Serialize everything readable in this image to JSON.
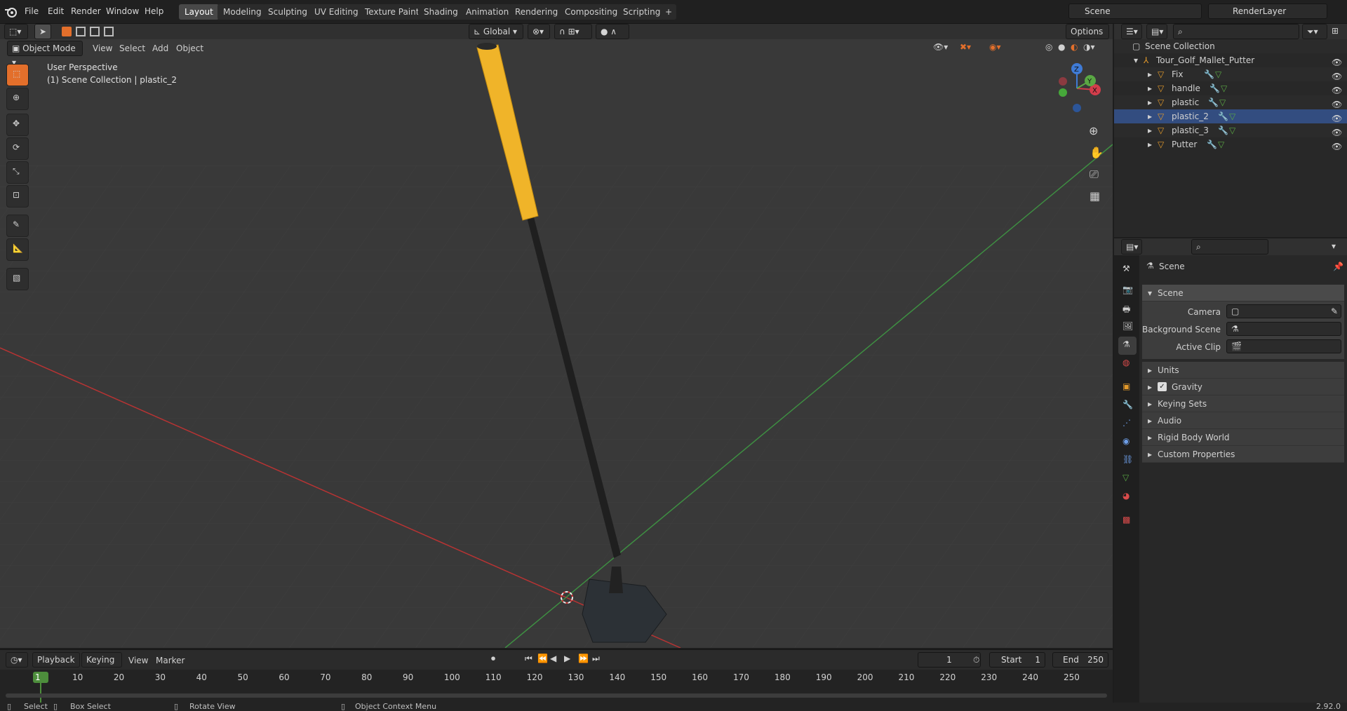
{
  "menus": [
    "File",
    "Edit",
    "Render",
    "Window",
    "Help"
  ],
  "workspaces": [
    "Layout",
    "Modeling",
    "Sculpting",
    "UV Editing",
    "Texture Paint",
    "Shading",
    "Animation",
    "Rendering",
    "Compositing",
    "Scripting"
  ],
  "active_workspace": "Layout",
  "add_workspace": "+",
  "scene_name": "Scene",
  "render_layer": "RenderLayer",
  "viewport": {
    "mode": "Object Mode",
    "menu_items": [
      "View",
      "Select",
      "Add",
      "Object"
    ],
    "orientation": "Global",
    "options_label": "Options",
    "overlay_title": "User Perspective",
    "overlay_subtitle": "(1) Scene Collection | plastic_2",
    "axes": {
      "x": "X",
      "y": "Y",
      "z": "Z"
    }
  },
  "outliner": {
    "search_placeholder": "",
    "root": "Scene Collection",
    "collection": "Tour_Golf_Mallet_Putter",
    "objects": [
      "Fix",
      "handle",
      "plastic",
      "plastic_2",
      "plastic_3",
      "Putter"
    ],
    "selected": "plastic_2"
  },
  "properties": {
    "context_label": "Scene",
    "panel_scene": "Scene",
    "fields": [
      {
        "label": "Camera"
      },
      {
        "label": "Background Scene"
      },
      {
        "label": "Active Clip"
      }
    ],
    "collapsed_panels": [
      "Units",
      "Gravity",
      "Keying Sets",
      "Audio",
      "Rigid Body World",
      "Custom Properties"
    ]
  },
  "timeline": {
    "menus": [
      "Playback",
      "Keying",
      "View",
      "Marker"
    ],
    "current_frame": "1",
    "start_label": "Start",
    "start_value": "1",
    "end_label": "End",
    "end_value": "250",
    "ticks": [
      "1",
      "10",
      "20",
      "30",
      "40",
      "50",
      "60",
      "70",
      "80",
      "90",
      "100",
      "110",
      "120",
      "130",
      "140",
      "150",
      "160",
      "170",
      "180",
      "190",
      "200",
      "210",
      "220",
      "230",
      "240",
      "250"
    ]
  },
  "status": {
    "select": "Select",
    "box_select": "Box Select",
    "rotate_view": "Rotate View",
    "context_menu": "Object Context Menu",
    "version": "2.92.0"
  },
  "colors": {
    "accent": "#e36f2b",
    "selected_tool": "#4f4f4f",
    "handle_grip": "#f0b429",
    "x_axis": "#b83333",
    "y_axis": "#3e8f42"
  }
}
